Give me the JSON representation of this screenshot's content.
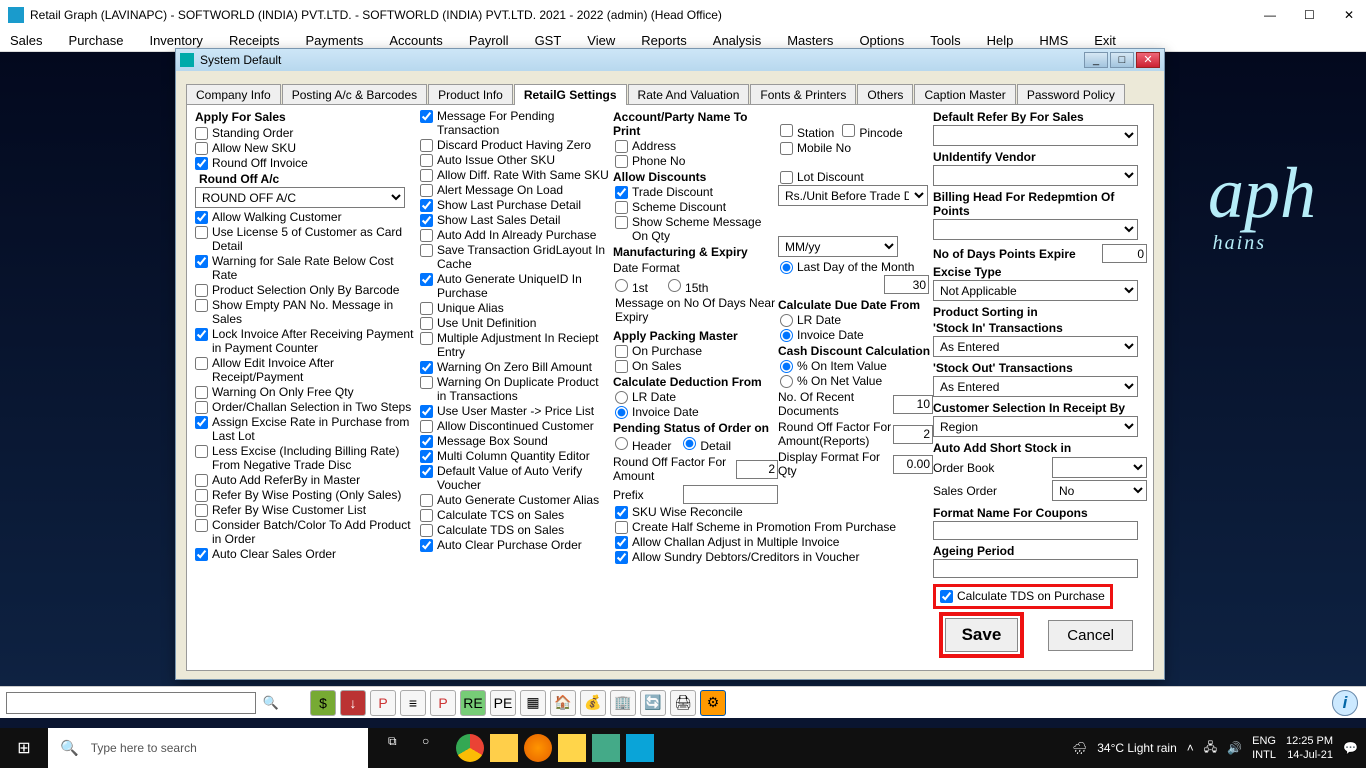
{
  "window": {
    "title": "Retail Graph (LAVINAPC) - SOFTWORLD (INDIA) PVT.LTD. - SOFTWORLD (INDIA) PVT.LTD.  2021 - 2022 (admin) (Head Office)"
  },
  "menubar": [
    "Sales",
    "Purchase",
    "Inventory",
    "Receipts",
    "Payments",
    "Accounts",
    "Payroll",
    "GST",
    "View",
    "Reports",
    "Analysis",
    "Masters",
    "Options",
    "Tools",
    "Help",
    "HMS",
    "Exit"
  ],
  "brand": {
    "main": "aph",
    "sub": "hains"
  },
  "dialog": {
    "title": "System Default",
    "tabs": [
      "Company Info",
      "Posting A/c & Barcodes",
      "Product Info",
      "RetailG Settings",
      "Rate And Valuation",
      "Fonts & Printers",
      "Others",
      "Caption Master",
      "Password Policy"
    ],
    "active_tab": "RetailG Settings",
    "buttons": {
      "save": "Save",
      "cancel": "Cancel"
    }
  },
  "col1": {
    "header": "Apply For Sales",
    "items": [
      {
        "label": "Standing Order",
        "checked": false
      },
      {
        "label": "Allow New SKU",
        "checked": false
      },
      {
        "label": "Round Off Invoice",
        "checked": true
      }
    ],
    "roundoff_label": "Round Off A/c",
    "roundoff_value": "ROUND OFF A/C",
    "items2": [
      {
        "label": "Allow Walking Customer",
        "checked": true
      },
      {
        "label": "Use License 5 of Customer as Card Detail",
        "checked": false
      },
      {
        "label": "Warning for Sale Rate Below Cost Rate",
        "checked": true
      },
      {
        "label": "Product Selection Only By Barcode",
        "checked": false
      },
      {
        "label": "Show Empty PAN No. Message in Sales",
        "checked": false
      },
      {
        "label": "Lock Invoice After Receiving Payment in Payment Counter",
        "checked": true
      },
      {
        "label": "Allow Edit Invoice After Receipt/Payment",
        "checked": false
      },
      {
        "label": "Warning On Only Free Qty",
        "checked": false
      },
      {
        "label": "Order/Challan Selection in Two Steps",
        "checked": false
      },
      {
        "label": "Assign Excise Rate in Purchase from Last Lot",
        "checked": true
      },
      {
        "label": "Less Excise (Including Billing Rate) From Negative Trade Disc",
        "checked": false
      },
      {
        "label": "Auto Add ReferBy in Master",
        "checked": false
      },
      {
        "label": "Refer By Wise Posting (Only Sales)",
        "checked": false
      },
      {
        "label": "Refer By Wise Customer List",
        "checked": false
      },
      {
        "label": "Consider Batch/Color To Add Product in Order",
        "checked": false
      },
      {
        "label": "Auto Clear Sales Order",
        "checked": true
      }
    ]
  },
  "col2": {
    "items": [
      {
        "label": "Message For Pending Transaction",
        "checked": true
      },
      {
        "label": "Discard Product Having Zero",
        "checked": false
      },
      {
        "label": "Auto Issue Other SKU",
        "checked": false
      },
      {
        "label": "Allow Diff. Rate With Same SKU",
        "checked": false
      },
      {
        "label": "Alert Message On Load",
        "checked": false
      },
      {
        "label": "Show Last Purchase Detail",
        "checked": true
      },
      {
        "label": "Show Last Sales Detail",
        "checked": true
      },
      {
        "label": "Auto Add In Already Purchase",
        "checked": false
      },
      {
        "label": "Save Transaction GridLayout In Cache",
        "checked": false
      },
      {
        "label": "Auto Generate UniqueID In Purchase",
        "checked": true
      },
      {
        "label": "Unique Alias",
        "checked": false
      },
      {
        "label": "Use Unit Definition",
        "checked": false
      },
      {
        "label": "Multiple Adjustment In Reciept Entry",
        "checked": false
      },
      {
        "label": "Warning On Zero Bill Amount",
        "checked": true
      },
      {
        "label": "Warning On Duplicate Product in Transactions",
        "checked": false
      },
      {
        "label": "Use User Master -> Price List",
        "checked": true
      },
      {
        "label": "Allow Discontinued Customer",
        "checked": false
      },
      {
        "label": "Message Box Sound",
        "checked": true
      },
      {
        "label": "Multi Column Quantity Editor",
        "checked": true
      },
      {
        "label": "Default Value of Auto Verify Voucher",
        "checked": true
      },
      {
        "label": "Auto Generate Customer Alias",
        "checked": false
      },
      {
        "label": "Calculate TCS on Sales",
        "checked": false
      },
      {
        "label": "Calculate TDS on Sales",
        "checked": false
      },
      {
        "label": "Auto Clear Purchase Order",
        "checked": true
      }
    ]
  },
  "col3": {
    "acct_hdr": "Account/Party Name To Print",
    "address": {
      "label": "Address",
      "checked": false
    },
    "phone": {
      "label": "Phone No",
      "checked": false
    },
    "allow_disc_hdr": "Allow Discounts",
    "trade": {
      "label": "Trade Discount",
      "checked": true
    },
    "scheme": {
      "label": "Scheme Discount",
      "checked": false
    },
    "show_scheme": {
      "label": "Show Scheme Message On Qty",
      "checked": false
    },
    "mfg_hdr": "Manufacturing & Expiry",
    "dateformat_lbl": "Date Format",
    "r1st": "1st",
    "r15th": "15th",
    "rlast": "Last  Day of the Month",
    "msg_exp_lbl": "Message on  No Of Days Near Expiry",
    "apply_pack_hdr": "Apply Packing Master",
    "on_purchase": {
      "label": "On Purchase",
      "checked": false
    },
    "on_sales": {
      "label": "On Sales",
      "checked": false
    },
    "calc_ded_hdr": "Calculate Deduction From",
    "lr": {
      "label": "LR Date"
    },
    "inv": {
      "label": "Invoice Date"
    },
    "pending_hdr": "Pending Status of Order on",
    "header_opt": "Header",
    "detail_opt": "Detail",
    "roundoff_lbl": "Round Off Factor For Amount",
    "prefix_lbl": "Prefix",
    "sku_rec": {
      "label": "SKU Wise Reconcile",
      "checked": true
    },
    "create_half": {
      "label": "Create Half Scheme in Promotion From Purchase",
      "checked": false
    },
    "allow_challan": {
      "label": "Allow Challan Adjust in Multiple Invoice",
      "checked": true
    },
    "allow_sundry": {
      "label": "Allow Sundry Debtors/Creditors in Voucher",
      "checked": true
    }
  },
  "col4": {
    "station": {
      "label": "Station",
      "checked": false
    },
    "pincode": {
      "label": "Pincode",
      "checked": false
    },
    "mobile": {
      "label": "Mobile No",
      "checked": false
    },
    "lot": {
      "label": "Lot Discount",
      "checked": false
    },
    "scheme_sel": "Rs./Unit Before Trade Disc.",
    "dateformat_val": "MM/yy",
    "msg_exp_val": "30",
    "calc_due_hdr": "Calculate Due Date From",
    "lr": "LR Date",
    "inv": "Invoice Date",
    "cash_hdr": "Cash Discount Calculation",
    "pct_item": "% On Item Value",
    "pct_net": "% On Net Value",
    "recent_lbl": "No. Of Recent Documents",
    "recent_val": "10",
    "rof_lbl": "Round Off Factor For Amount(Reports)",
    "rof_val": "2",
    "disp_lbl": "Display Format For Qty",
    "disp_val": "0.00",
    "roundoff_amt_val": "2"
  },
  "col5": {
    "def_refer_lbl": "Default Refer By For Sales",
    "unid_lbl": "UnIdentify Vendor",
    "billhead_lbl": "Billing Head For Redepmtion Of Points",
    "days_lbl": "No of Days Points Expire",
    "days_val": "0",
    "excise_lbl": "Excise Type",
    "excise_val": "Not Applicable",
    "prodsort_lbl": "Product Sorting in",
    "stockin_lbl": "'Stock In' Transactions",
    "stockin_val": "As Entered",
    "stockout_lbl": "'Stock Out' Transactions",
    "stockout_val": "As Entered",
    "cust_sel_lbl": "Customer Selection In Receipt By",
    "cust_sel_val": "Region",
    "auto_short_lbl": "Auto Add Short Stock in",
    "order_book_lbl": "Order Book",
    "sales_order_lbl": "Sales Order",
    "sales_order_val": "No",
    "coupon_lbl": "Format Name For Coupons",
    "ageing_lbl": "Ageing Period",
    "tds_pur": {
      "label": "Calculate TDS on Purchase",
      "checked": true
    }
  },
  "taskbar": {
    "search_ph": "Type here to search",
    "weather": "34°C  Light rain",
    "lang1": "ENG",
    "lang2": "INTL",
    "time": "12:25 PM",
    "date": "14-Jul-21"
  }
}
